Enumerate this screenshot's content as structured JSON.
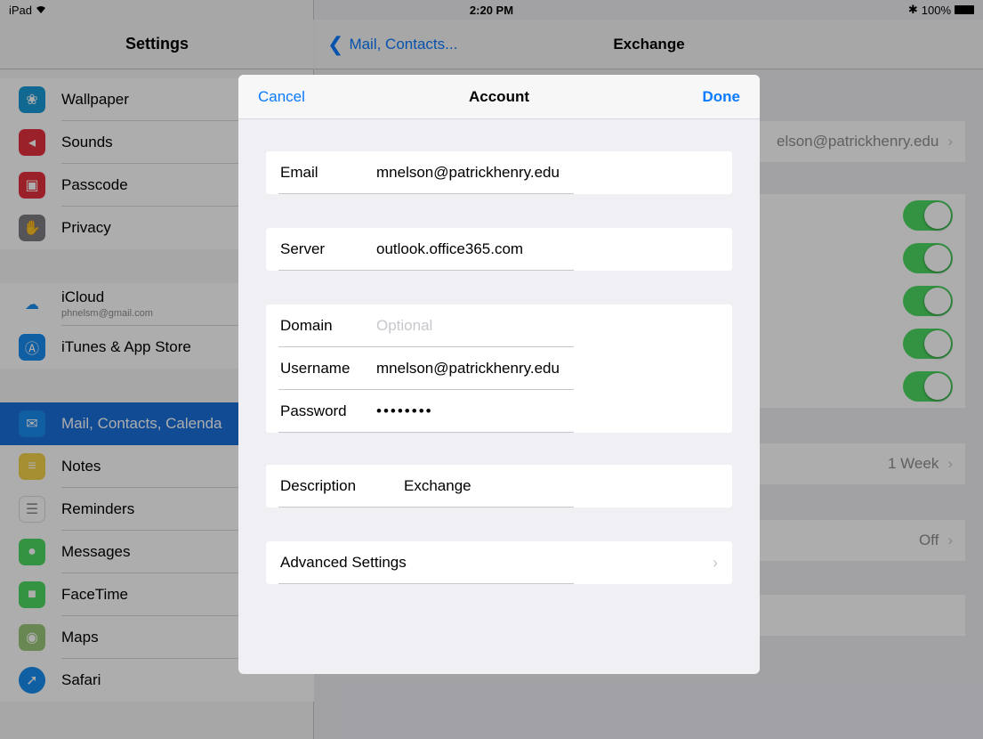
{
  "status_bar": {
    "device": "iPad",
    "time": "2:20 PM",
    "battery": "100%"
  },
  "sidebar": {
    "title": "Settings",
    "items": [
      {
        "label": "Wallpaper",
        "icon": "wallpaper-icon",
        "color": "#1a9bd7"
      },
      {
        "label": "Sounds",
        "icon": "sounds-icon",
        "color": "#e4323d"
      },
      {
        "label": "Passcode",
        "icon": "passcode-icon",
        "color": "#e4323d"
      },
      {
        "label": "Privacy",
        "icon": "privacy-icon",
        "color": "#7d7d83"
      },
      {
        "label": "iCloud",
        "sublabel": "phnelsm@gmail.com",
        "icon": "icloud-icon",
        "color": "#ffffff"
      },
      {
        "label": "iTunes & App Store",
        "icon": "app-store-icon",
        "color": "#1a8cf0"
      },
      {
        "label": "Mail, Contacts, Calenda",
        "icon": "mail-icon",
        "color": "#1a8cf0"
      },
      {
        "label": "Notes",
        "icon": "notes-icon",
        "color": "#f5d24a"
      },
      {
        "label": "Reminders",
        "icon": "reminders-icon",
        "color": "#ffffff"
      },
      {
        "label": "Messages",
        "icon": "messages-icon",
        "color": "#4cd964"
      },
      {
        "label": "FaceTime",
        "icon": "facetime-icon",
        "color": "#4cd964"
      },
      {
        "label": "Maps",
        "icon": "maps-icon",
        "color": "#9ac77a"
      },
      {
        "label": "Safari",
        "icon": "safari-icon",
        "color": "#1a8cf0"
      }
    ]
  },
  "detail": {
    "back_label": "Mail, Contacts...",
    "title": "Exchange",
    "account_value": "elson@patrickhenry.edu",
    "mail_days_value": "1 Week",
    "auto_reply_value": "Off"
  },
  "modal": {
    "cancel_label": "Cancel",
    "title": "Account",
    "done_label": "Done",
    "email_label": "Email",
    "email_value": "mnelson@patrickhenry.edu",
    "server_label": "Server",
    "server_value": "outlook.office365.com",
    "domain_label": "Domain",
    "domain_placeholder": "Optional",
    "username_label": "Username",
    "username_value": "mnelson@patrickhenry.edu",
    "password_label": "Password",
    "password_value": "••••••••",
    "description_label": "Description",
    "description_value": "Exchange",
    "advanced_label": "Advanced Settings"
  }
}
